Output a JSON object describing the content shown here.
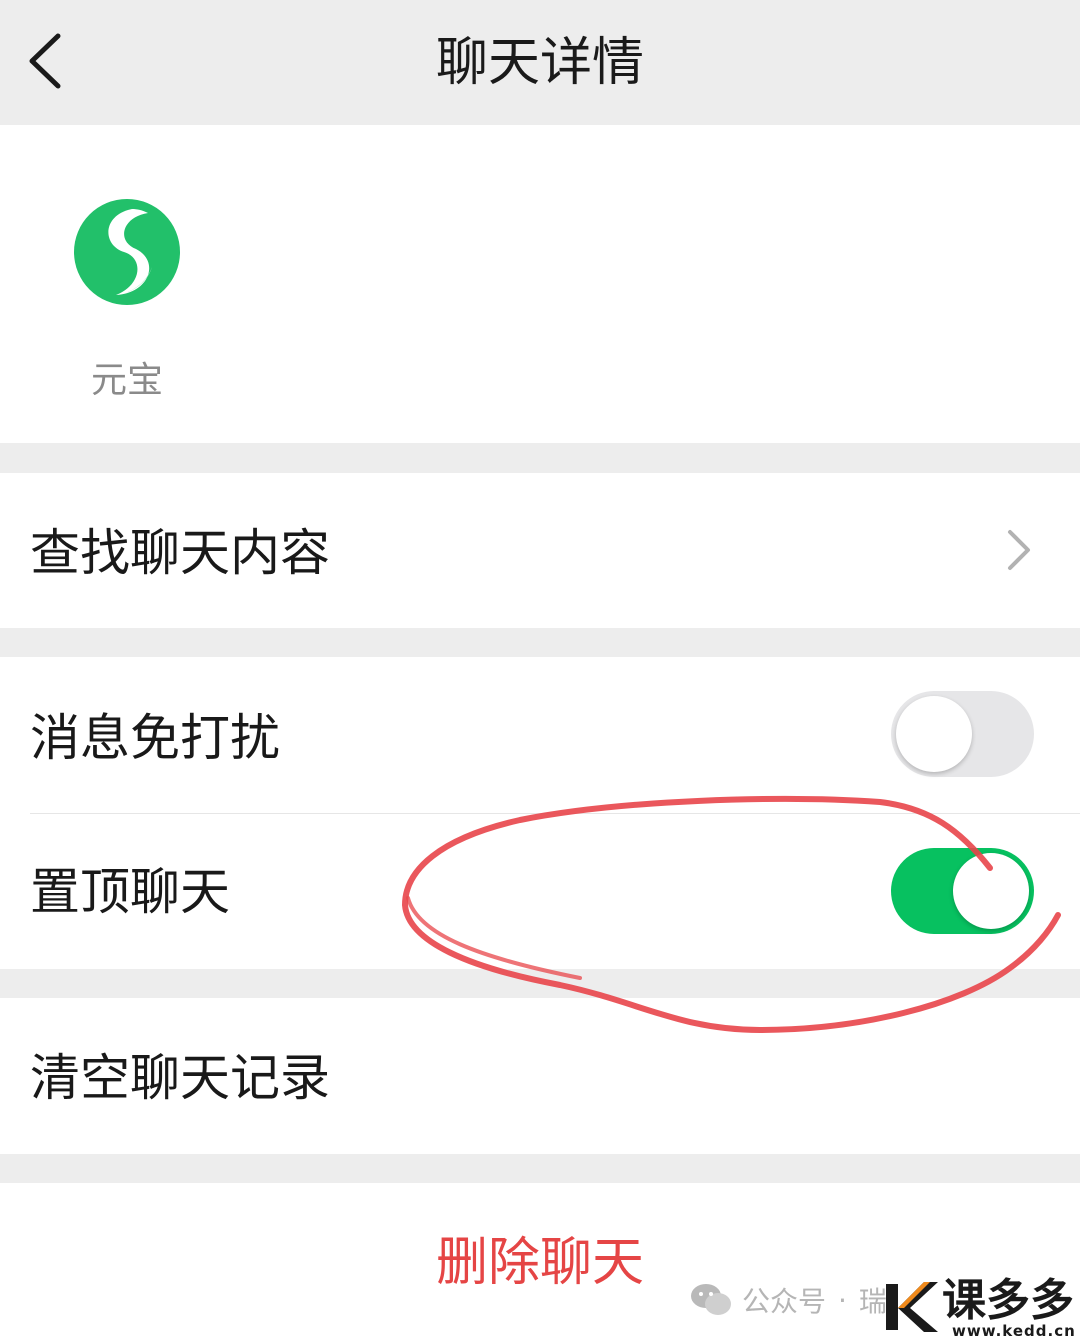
{
  "header": {
    "title": "聊天详情",
    "back_icon": "chevron-left-icon"
  },
  "member": {
    "name": "元宝",
    "avatar_icon": "yuanbao-logo-icon",
    "avatar_color": "#22c06a"
  },
  "settings": {
    "search_label": "查找聊天内容",
    "mute_label": "消息免打扰",
    "mute_enabled": false,
    "pin_label": "置顶聊天",
    "pin_enabled": true,
    "clear_label": "清空聊天记录",
    "delete_label": "删除聊天"
  },
  "colors": {
    "accent": "#07c160",
    "danger": "#e54545",
    "annotation": "#e8454a"
  },
  "watermark": {
    "prefix": "公众号",
    "dot": "·",
    "name": "瑞",
    "icon": "wechat-icon"
  },
  "site_logo": {
    "name": "课多多",
    "url": "www.kedd.cn"
  }
}
